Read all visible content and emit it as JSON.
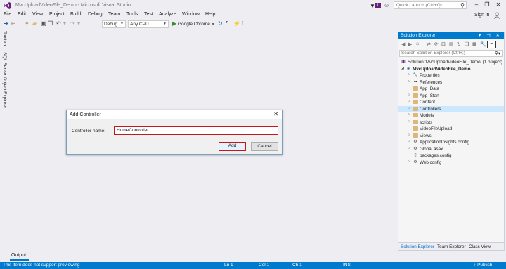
{
  "titlebar": {
    "title": "MvcUploadVideoFile_Demo - Microsoft Visual Studio",
    "notification_count": "1",
    "quick_launch_placeholder": "Quick Launch (Ctrl+Q)"
  },
  "menu": [
    "File",
    "Edit",
    "View",
    "Project",
    "Build",
    "Debug",
    "Team",
    "Tools",
    "Test",
    "Analyze",
    "Window",
    "Help"
  ],
  "signin": "Sign in",
  "toolbar": {
    "config": "Debug",
    "platform": "Any CPU",
    "run_target": "Google Chrome"
  },
  "side_tabs": [
    "Toolbox",
    "SQL Server Object Explorer"
  ],
  "dialog": {
    "title": "Add Controller",
    "label": "Controller name:",
    "value": "HomeController",
    "add_label": "Add",
    "cancel_label": "Cancel"
  },
  "solution_explorer": {
    "title": "Solution Explorer",
    "search_placeholder": "Search Solution Explorer (Ctrl+;)",
    "tree": [
      "Solution 'MvcUploadVideoFile_Demo' (1 project)",
      "MvcUploadVideoFile_Demo",
      "Properties",
      "References",
      "App_Data",
      "App_Start",
      "Content",
      "Controllers",
      "Models",
      "scripts",
      "VideoFileUpload",
      "Views",
      "ApplicationInsights.config",
      "Global.asax",
      "packages.config",
      "Web.config"
    ],
    "tabs": [
      "Solution Explorer",
      "Team Explorer",
      "Class View"
    ]
  },
  "output_tab": "Output",
  "statusbar": {
    "message": "This item does not support previewing",
    "line": "Ln 1",
    "col": "Col 1",
    "ch": "Ch 1",
    "mode": "INS",
    "publish": "Publish"
  }
}
